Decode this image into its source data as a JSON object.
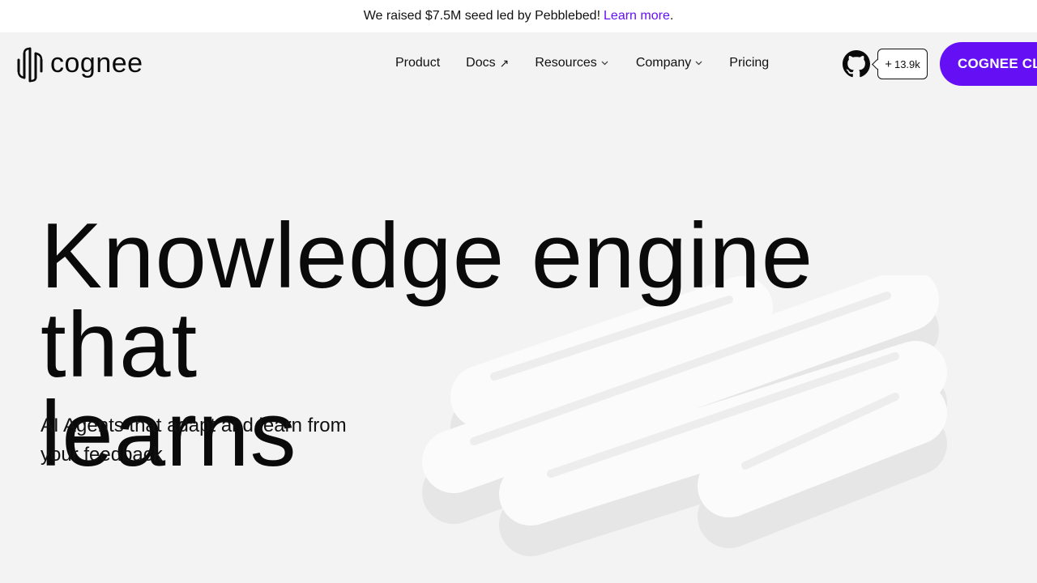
{
  "announcement": {
    "text": "We raised $7.5M seed led by Pebblebed!",
    "link_text": "Learn more",
    "suffix": "."
  },
  "brand": {
    "name": "cognee",
    "accent_color": "#6510f4"
  },
  "nav": {
    "items": [
      {
        "label": "Product",
        "icon": ""
      },
      {
        "label": "Docs",
        "icon": "↗"
      },
      {
        "label": "Resources",
        "icon": "chevron-down-icon"
      },
      {
        "label": "Company",
        "icon": "chevron-down-icon"
      },
      {
        "label": "Pricing",
        "icon": ""
      }
    ]
  },
  "github": {
    "icon": "github-icon",
    "stars": "13.9k"
  },
  "cta": {
    "label": "COGNEE CL"
  },
  "hero": {
    "headline_line1": "Knowledge engine that",
    "headline_line2": "learns",
    "subheading": "AI Agents that adapt and learn from your feedback"
  }
}
